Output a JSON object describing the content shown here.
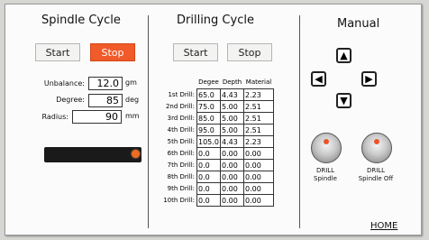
{
  "spindle": {
    "title": "Spindle Cycle",
    "start_label": "Start",
    "stop_label": "Stop",
    "unbalance_label": "Unbalance:",
    "unbalance_value": "12.0",
    "unbalance_unit": "gm",
    "degree_label": "Degree:",
    "degree_value": "85",
    "degree_unit": "deg",
    "radius_label": "Radius:",
    "radius_value": "90",
    "radius_unit": "mm",
    "slider_level": 1.0
  },
  "drilling": {
    "title": "Drilling Cycle",
    "start_label": "Start",
    "stop_label": "Stop",
    "headers": [
      "Degee",
      "Depth",
      "Material"
    ],
    "rows": [
      {
        "label": "1st Drill:",
        "degree": "65.0",
        "depth": "4.43",
        "material": "2.23"
      },
      {
        "label": "2nd Drill:",
        "degree": "75.0",
        "depth": "5.00",
        "material": "2.51"
      },
      {
        "label": "3rd Drill:",
        "degree": "85.0",
        "depth": "5.00",
        "material": "2.51"
      },
      {
        "label": "4th Drill:",
        "degree": "95.0",
        "depth": "5.00",
        "material": "2.51"
      },
      {
        "label": "5th Drill:",
        "degree": "105.0",
        "depth": "4.43",
        "material": "2.23"
      },
      {
        "label": "6th Drill:",
        "degree": "0.0",
        "depth": "0.00",
        "material": "0.00"
      },
      {
        "label": "7th Drill:",
        "degree": "0.0",
        "depth": "0.00",
        "material": "0.00"
      },
      {
        "label": "8th Drill:",
        "degree": "0.0",
        "depth": "0.00",
        "material": "0.00"
      },
      {
        "label": "9th Drill:",
        "degree": "0.0",
        "depth": "0.00",
        "material": "0.00"
      },
      {
        "label": "10th Drill:",
        "degree": "0.0",
        "depth": "0.00",
        "material": "0.00"
      }
    ]
  },
  "manual": {
    "title": "Manual",
    "up_icon": "arrow-up-icon",
    "left_icon": "arrow-left-icon",
    "right_icon": "arrow-right-icon",
    "down_icon": "arrow-down-icon",
    "drill_spindle_label_1": "DRILL",
    "drill_spindle_label_2": "Spindle",
    "drill_spindle_off_label_1": "DRILL",
    "drill_spindle_off_label_2": "Spindle Off",
    "home_label": "HOME"
  },
  "colors": {
    "stop_active": "#f15a29",
    "indicator": "#ee6b22"
  }
}
